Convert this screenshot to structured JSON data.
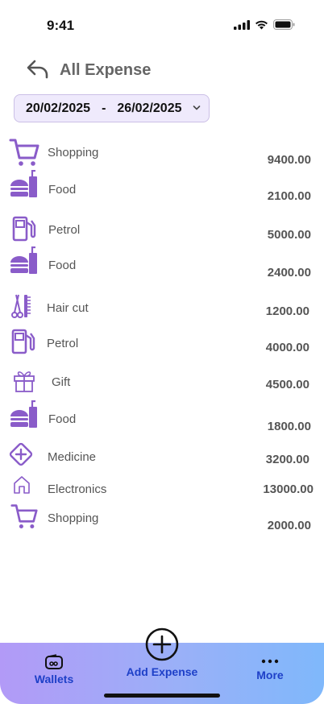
{
  "status": {
    "time": "9:41"
  },
  "header": {
    "title": "All Expense"
  },
  "date_range": {
    "start": "20/02/2025",
    "separator": "-",
    "end": "26/02/2025"
  },
  "expenses": [
    {
      "category": "Shopping",
      "amount": "9400.00",
      "icon": "cart-icon"
    },
    {
      "category": "Food",
      "amount": "2100.00",
      "icon": "burger-drink-icon"
    },
    {
      "category": "Petrol",
      "amount": "5000.00",
      "icon": "fuel-pump-icon"
    },
    {
      "category": "Food",
      "amount": "2400.00",
      "icon": "burger-drink-icon"
    },
    {
      "category": "Hair cut",
      "amount": "1200.00",
      "icon": "scissors-comb-icon"
    },
    {
      "category": "Petrol",
      "amount": "4000.00",
      "icon": "fuel-pump-icon"
    },
    {
      "category": "Gift",
      "amount": "4500.00",
      "icon": "gift-icon"
    },
    {
      "category": "Food",
      "amount": "1800.00",
      "icon": "burger-drink-icon"
    },
    {
      "category": "Medicine",
      "amount": "3200.00",
      "icon": "medical-plus-icon"
    },
    {
      "category": "Electronics",
      "amount": "13000.00",
      "icon": "home-icon"
    },
    {
      "category": "Shopping",
      "amount": "2000.00",
      "icon": "cart-icon"
    }
  ],
  "bottom_nav": {
    "wallets": "Wallets",
    "add_expense": "Add Expense",
    "more": "More"
  },
  "colors": {
    "accent": "#8a5cc9",
    "nav_text": "#1e40c8"
  }
}
